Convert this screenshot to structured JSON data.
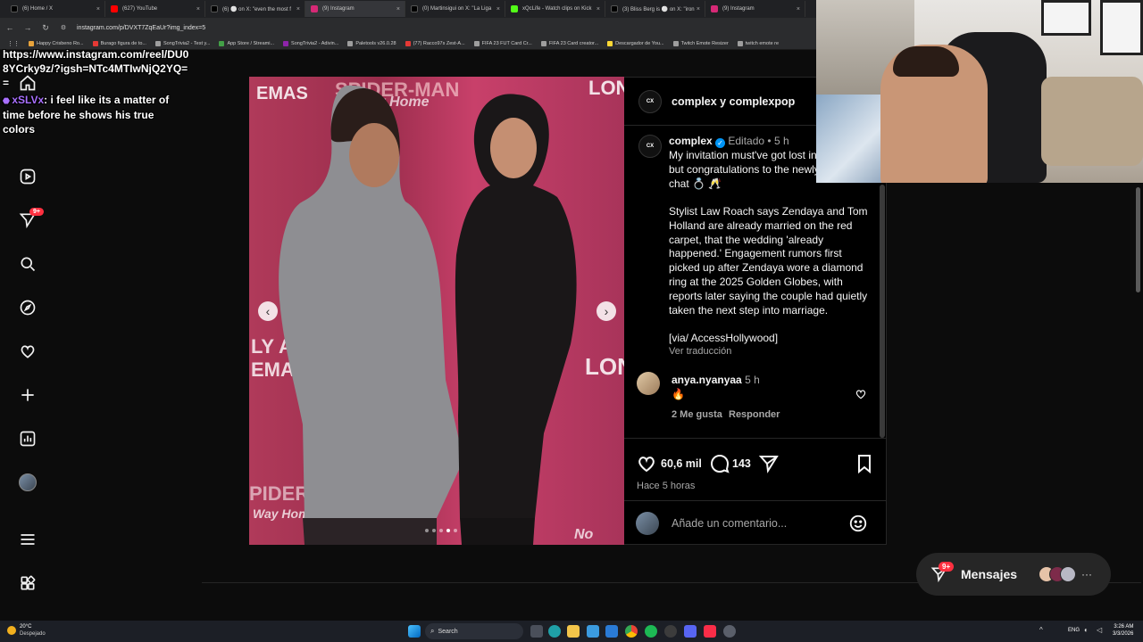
{
  "browser": {
    "tabs": [
      {
        "label": "(6) Home / X",
        "color": "#000000"
      },
      {
        "label": "(627) YouTube",
        "color": "#ff0000"
      },
      {
        "label": "(6) ⚪ on X: \"even the most f",
        "color": "#000000"
      },
      {
        "label": "(9) Instagram",
        "color": "#d62976"
      },
      {
        "label": "(0) Martinsigui on X: \"La Liga",
        "color": "#000000"
      },
      {
        "label": "xQcLife - Watch clips on Kick",
        "color": "#53fc18"
      },
      {
        "label": "(3) Bliss Berg is ⚪ on X: \"iron",
        "color": "#000000"
      },
      {
        "label": "(9) Instagram",
        "color": "#d62976"
      }
    ],
    "url": "instagram.com/p/DVXT7ZqEaUr?img_index=5",
    "bookmarks": [
      "Happy Crisbeno Ro...",
      "Burago figura de to...",
      "SongTrivia2 - Test y...",
      "App Store / Streami...",
      "SongTrivia2 - Adivin...",
      "Paletools v26.0.28",
      "(77) Racco97s Zest-A...",
      "FIFA 23 FUT Card Cr...",
      "FIFA 23 Card creator...",
      "Descargador de You...",
      "Twitch Emote Resizer",
      "twitch emote re"
    ]
  },
  "chat": {
    "line1": "https://www.instagram.com/reel/DU08YCrky9z/?igsh=NTc4MTIwNjQ2YQ==",
    "username": "xSLVx",
    "message": ": i feel like its a matter of time before he shows his true colors"
  },
  "sidebar": {
    "notif_badge": "9+",
    "icons": [
      "home-icon",
      "reels-icon",
      "messages-icon",
      "search-icon",
      "explore-icon",
      "heart-icon",
      "create-icon",
      "insights-icon",
      "profile-avatar",
      "menu-icon",
      "more-apps-icon"
    ]
  },
  "media": {
    "poster_lines": [
      "SPIDER-MAN",
      "Way Home",
      "LON",
      "EMAS",
      "LY AT",
      "EMAS",
      "LONI",
      "Way Home",
      "No Way",
      "PIDER-MA"
    ]
  },
  "post": {
    "header_account": "complex y complexpop",
    "author": "complex",
    "edited": "Editado",
    "age": "5 h",
    "caption_p1": "My invitation must've got lost in the mail, but congratulations to the newly weds chat 💍 🥂",
    "caption_p2": "Stylist Law Roach says Zendaya and Tom Holland are already married on the red carpet, that the wedding 'already happened.' Engagement rumors first picked up after Zendaya wore a diamond ring at the 2025 Golden Globes, with reports later saying the couple had quietly taken the next step into marriage.",
    "caption_p3": "[via/ AccessHollywood]",
    "translate": "Ver traducción",
    "comment": {
      "user": "anya.nyanyaa",
      "age": "5 h",
      "text": "🔥",
      "likes": "2 Me gusta",
      "reply": "Responder"
    },
    "likes_count": "60,6 mil",
    "comments_count": "143",
    "time_ago": "Hace 5 horas",
    "add_comment_placeholder": "Añade un comentario..."
  },
  "messages": {
    "label": "Mensajes",
    "badge": "9+"
  },
  "taskbar": {
    "weather_temp": "20°C",
    "weather_desc": "Despejado",
    "search": "Search",
    "lang": "ENG",
    "time": "3:26 AM",
    "date": "3/3/2026"
  },
  "colors": {
    "ig_badge": "#ff3040",
    "verified": "#0095f6",
    "twitch_user": "#a970ff"
  }
}
